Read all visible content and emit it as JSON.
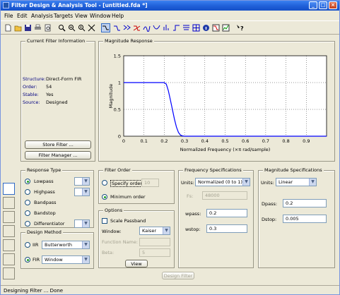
{
  "window": {
    "title": "Filter Design & Analysis Tool - [untitled.fda *]"
  },
  "menu": [
    "File",
    "Edit",
    "Analysis",
    "Targets",
    "View",
    "Window",
    "Help"
  ],
  "toolbar": {
    "icons": [
      "new-icon",
      "open-icon",
      "save-icon",
      "print-icon",
      "print-preview-icon",
      "zoom-in-icon",
      "zoom-x-icon",
      "zoom-y-icon",
      "full-view-icon",
      "filter-specs-icon",
      "magnitude-response-icon",
      "phase-response-icon",
      "mag-phase-icon",
      "group-delay-icon",
      "phase-delay-icon",
      "impulse-response-icon",
      "step-response-icon",
      "pole-zero-icon",
      "filter-coefficients-icon",
      "filter-info-icon",
      "magnitude-estimate-icon",
      "noise-psd-icon",
      "whats-this-icon"
    ]
  },
  "current_filter": {
    "title": "Current Filter Information",
    "rows": [
      {
        "label": "Structure:",
        "value": "Direct-Form FIR"
      },
      {
        "label": "Order:",
        "value": "54"
      },
      {
        "label": "Stable:",
        "value": "Yes"
      },
      {
        "label": "Source:",
        "value": "Designed"
      }
    ],
    "store_button": "Store Filter ...",
    "manager_button": "Filter Manager ..."
  },
  "magnitude_panel": {
    "title": "Magnitude Response"
  },
  "chart_data": {
    "type": "line",
    "title": "",
    "xlabel": "Normalized Frequency (×π rad/sample)",
    "ylabel": "Magnitude",
    "xlim": [
      0,
      1
    ],
    "ylim": [
      0,
      1.5
    ],
    "xticks": [
      "0",
      "0.1",
      "0.2",
      "0.3",
      "0.4",
      "0.5",
      "0.6",
      "0.7",
      "0.8",
      "0.9"
    ],
    "yticks": [
      "0",
      "0.5",
      "1",
      "1.5"
    ],
    "grid": true,
    "series": [
      {
        "x": [
          0,
          0.05,
          0.1,
          0.15,
          0.19,
          0.2,
          0.21,
          0.22,
          0.23,
          0.24,
          0.25,
          0.26,
          0.27,
          0.28,
          0.29,
          0.3,
          0.4,
          0.5,
          0.6,
          0.7,
          0.8,
          0.9,
          1.0
        ],
        "values": [
          1,
          1,
          1,
          1,
          1,
          1,
          0.97,
          0.85,
          0.68,
          0.5,
          0.32,
          0.17,
          0.07,
          0.02,
          0.005,
          0,
          0,
          0,
          0,
          0,
          0,
          0,
          0
        ],
        "color": "#0000ff"
      }
    ]
  },
  "response_type": {
    "title": "Response Type",
    "options": [
      "Lowpass",
      "Highpass",
      "Bandpass",
      "Bandstop",
      "Differentiator"
    ],
    "selected": 0
  },
  "design_method": {
    "title": "Design Method",
    "iir_label": "IIR",
    "iir_value": "Butterworth",
    "fir_label": "FIR",
    "fir_value": "Window"
  },
  "filter_order": {
    "title": "Filter Order",
    "specify_label": "Specify order:",
    "specify_value": "10",
    "minimum_label": "Minimum order"
  },
  "options": {
    "title": "Options",
    "scale_label": "Scale Passband",
    "window_label": "Window:",
    "window_value": "Kaiser",
    "function_label": "Function Name:",
    "beta_label": "Beta:",
    "beta_value": "5",
    "view_button": "View"
  },
  "freq_specs": {
    "title": "Frequency Specifications",
    "units_label": "Units:",
    "units_value": "Normalized (0 to 1)",
    "fs_label": "Fs:",
    "fs_value": "48000",
    "wpass_label": "wpass:",
    "wpass_value": "0.2",
    "wstop_label": "wstop:",
    "wstop_value": "0.3"
  },
  "mag_specs": {
    "title": "Magnitude Specifications",
    "units_label": "Units:",
    "units_value": "Linear",
    "dpass_label": "Dpass:",
    "dpass_value": "0.2",
    "dstop_label": "Dstop:",
    "dstop_value": "0.005"
  },
  "design_button": "Design Filter",
  "status": "Designing Filter ... Done"
}
